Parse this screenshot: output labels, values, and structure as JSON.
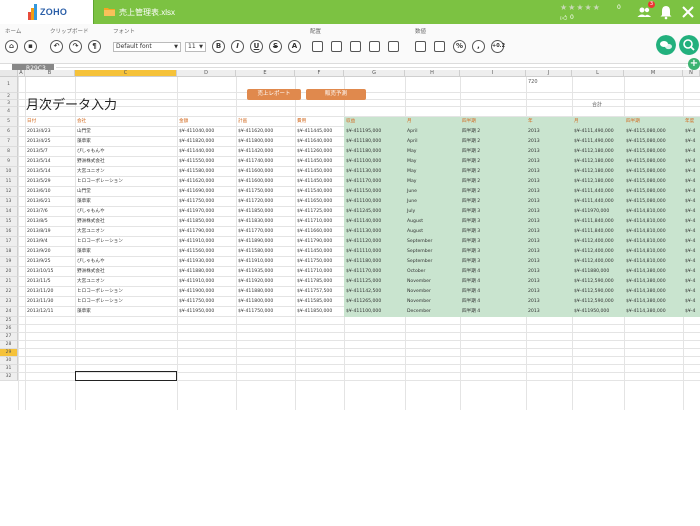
{
  "app": {
    "logo_text": "ZOHO",
    "file_name": "売上管理表.xlsx",
    "rating_count": "0",
    "like_count": "0",
    "notification_count": "3"
  },
  "ribbon": {
    "groups": [
      "ホーム",
      "クリップボード",
      "フォント",
      "配置",
      "数値"
    ],
    "font_name": "Default font",
    "font_size": "11",
    "number_format_label": "+0.2"
  },
  "namebox": {
    "cell_ref": "R29C3"
  },
  "grid": {
    "columns": [
      "A",
      "B",
      "C",
      "D",
      "E",
      "F",
      "G",
      "H",
      "I",
      "J",
      "L",
      "M",
      "N"
    ],
    "selected_column": "C",
    "selected_row": "29",
    "row_numbers": [
      "1",
      "2",
      "3",
      "4",
      "5",
      "6",
      "7",
      "8",
      "9",
      "10",
      "11",
      "12",
      "13",
      "14",
      "15",
      "16",
      "17",
      "18",
      "19",
      "20",
      "21",
      "22",
      "23",
      "24",
      "25",
      "26",
      "27",
      "28",
      "29",
      "30",
      "31",
      "32"
    ]
  },
  "sheet": {
    "title": "月次データ入力",
    "btn_sales_report": "売上レポート",
    "btn_sales_forecast": "販売予測",
    "j1_value": "720",
    "l3_value": "合計",
    "headers": [
      "日付",
      "会社",
      "金額",
      "計画",
      "費用",
      "収益",
      "月",
      "四半期",
      "年",
      "月",
      "四半期",
      "年度"
    ],
    "rows": [
      [
        "2013/4/23",
        "山門堂",
        "$¥-411040,000",
        "$¥-411620,000",
        "$¥-411445,000",
        "$¥-411195,000",
        "April",
        "四半期 2",
        "2013",
        "$¥-4111,490,000",
        "$¥-4115,080,000",
        "$¥-4"
      ],
      [
        "2013/4/25",
        "藻草家",
        "$¥-411820,000",
        "$¥-411800,000",
        "$¥-411640,000",
        "$¥-411180,000",
        "April",
        "四半期 2",
        "2013",
        "$¥-4111,490,000",
        "$¥-4115,080,000",
        "$¥-4"
      ],
      [
        "2013/5/7",
        "ぴしゃもんや",
        "$¥-411440,000",
        "$¥-411420,000",
        "$¥-411260,000",
        "$¥-411180,000",
        "May",
        "四半期 2",
        "2013",
        "$¥-4112,180,000",
        "$¥-4115,080,000",
        "$¥-4"
      ],
      [
        "2013/5/14",
        "野洲株式会社",
        "$¥-411550,000",
        "$¥-411740,000",
        "$¥-411450,000",
        "$¥-411100,000",
        "May",
        "四半期 2",
        "2013",
        "$¥-4112,180,000",
        "$¥-4115,080,000",
        "$¥-4"
      ],
      [
        "2013/5/14",
        "大宮ユニオン",
        "$¥-411580,000",
        "$¥-411600,000",
        "$¥-411450,000",
        "$¥-411130,000",
        "May",
        "四半期 2",
        "2013",
        "$¥-4112,180,000",
        "$¥-4115,080,000",
        "$¥-4"
      ],
      [
        "2013/5/29",
        "ヒロコーポレーション",
        "$¥-411620,000",
        "$¥-411600,000",
        "$¥-411450,000",
        "$¥-411170,000",
        "May",
        "四半期 2",
        "2013",
        "$¥-4112,180,000",
        "$¥-4115,080,000",
        "$¥-4"
      ],
      [
        "2013/6/10",
        "山門堂",
        "$¥-411690,000",
        "$¥-411750,000",
        "$¥-411540,000",
        "$¥-411150,000",
        "June",
        "四半期 2",
        "2013",
        "$¥-4111,440,000",
        "$¥-4115,080,000",
        "$¥-4"
      ],
      [
        "2013/6/21",
        "藻草家",
        "$¥-411750,000",
        "$¥-411720,000",
        "$¥-411650,000",
        "$¥-411100,000",
        "June",
        "四半期 2",
        "2013",
        "$¥-4111,440,000",
        "$¥-4115,080,000",
        "$¥-4"
      ],
      [
        "2013/7/6",
        "ぴしゃもんや",
        "$¥-411970,000",
        "$¥-411850,000",
        "$¥-411725,000",
        "$¥-411245,000",
        "July",
        "四半期 3",
        "2013",
        "$¥-411970,000",
        "$¥-4114,810,000",
        "$¥-4"
      ],
      [
        "2013/8/5",
        "野洲株式会社",
        "$¥-411850,000",
        "$¥-411830,000",
        "$¥-411710,000",
        "$¥-411140,000",
        "August",
        "四半期 3",
        "2013",
        "$¥-4111,840,000",
        "$¥-4114,810,000",
        "$¥-4"
      ],
      [
        "2013/8/19",
        "大宮ユニオン",
        "$¥-411790,000",
        "$¥-411770,000",
        "$¥-411660,000",
        "$¥-411130,000",
        "August",
        "四半期 3",
        "2013",
        "$¥-4111,840,000",
        "$¥-4114,810,000",
        "$¥-4"
      ],
      [
        "2013/9/4",
        "ヒロコーポレーション",
        "$¥-411910,000",
        "$¥-411890,000",
        "$¥-411790,000",
        "$¥-411120,000",
        "September",
        "四半期 3",
        "2013",
        "$¥-4112,400,000",
        "$¥-4114,810,000",
        "$¥-4"
      ],
      [
        "2013/9/20",
        "藻草家",
        "$¥-411560,000",
        "$¥-411580,000",
        "$¥-411450,000",
        "$¥-411110,000",
        "September",
        "四半期 3",
        "2013",
        "$¥-4112,400,000",
        "$¥-4114,810,000",
        "$¥-4"
      ],
      [
        "2013/9/25",
        "ぴしゃもんや",
        "$¥-411930,000",
        "$¥-411910,000",
        "$¥-411750,000",
        "$¥-411180,000",
        "September",
        "四半期 3",
        "2013",
        "$¥-4112,400,000",
        "$¥-4114,810,000",
        "$¥-4"
      ],
      [
        "2013/10/15",
        "野洲株式会社",
        "$¥-411880,000",
        "$¥-411935,000",
        "$¥-411710,000",
        "$¥-411170,000",
        "October",
        "四半期 4",
        "2013",
        "$¥-411880,000",
        "$¥-4114,380,000",
        "$¥-4"
      ],
      [
        "2013/11/5",
        "大宮ユニオン",
        "$¥-411910,000",
        "$¥-411920,000",
        "$¥-411785,000",
        "$¥-411125,000",
        "November",
        "四半期 4",
        "2013",
        "$¥-4112,590,000",
        "$¥-4114,380,000",
        "$¥-4"
      ],
      [
        "2013/11/20",
        "ヒロコーポレーション",
        "$¥-411900,000",
        "$¥-411880,000",
        "$¥-411757,500",
        "$¥-411142,500",
        "November",
        "四半期 4",
        "2013",
        "$¥-4112,590,000",
        "$¥-4114,380,000",
        "$¥-4"
      ],
      [
        "2013/11/30",
        "ヒロコーポレーション",
        "$¥-411750,000",
        "$¥-411800,000",
        "$¥-411585,000",
        "$¥-411265,000",
        "November",
        "四半期 4",
        "2013",
        "$¥-4112,590,000",
        "$¥-4114,380,000",
        "$¥-4"
      ],
      [
        "2013/12/11",
        "藻草家",
        "$¥-411950,000",
        "$¥-411750,000",
        "$¥-411850,000",
        "$¥-411100,000",
        "December",
        "四半期 4",
        "2013",
        "$¥-411950,000",
        "$¥-4114,380,000",
        "$¥-4"
      ]
    ]
  },
  "colors": {
    "titlebar": "#7cc242",
    "selection": "#f5c23a",
    "green_fill": "#c9e4cf",
    "button_orange": "#e0894d",
    "header_text": "#d2691e"
  }
}
